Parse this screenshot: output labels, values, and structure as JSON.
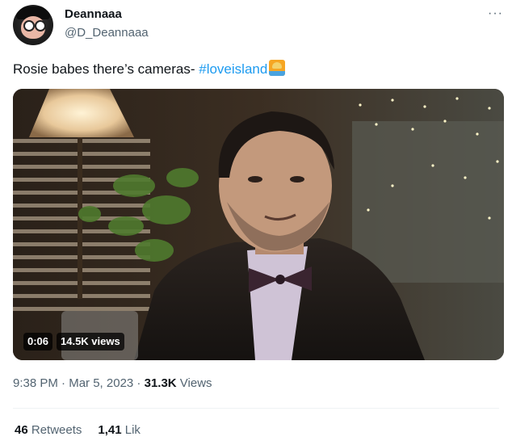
{
  "author": {
    "display_name": "Deannaaa",
    "handle": "@D_Deannaaa"
  },
  "menu": {
    "more_icon": "more-horizontal-icon",
    "more_glyph": "···"
  },
  "tweet": {
    "text": "Rosie babes there’s cameras- ",
    "hashtag": "#loveisland",
    "emoji": "sunset-emoji"
  },
  "video": {
    "duration": "0:06",
    "views": "14.5K views"
  },
  "meta": {
    "time": "9:38 PM",
    "separator": " · ",
    "date": "Mar 5, 2023",
    "views_count": "31.3K",
    "views_label": " Views"
  },
  "stats": {
    "retweets_count": "46",
    "retweets_label": " Retweets",
    "likes_count": "1,41",
    "likes_label": " Lik"
  }
}
